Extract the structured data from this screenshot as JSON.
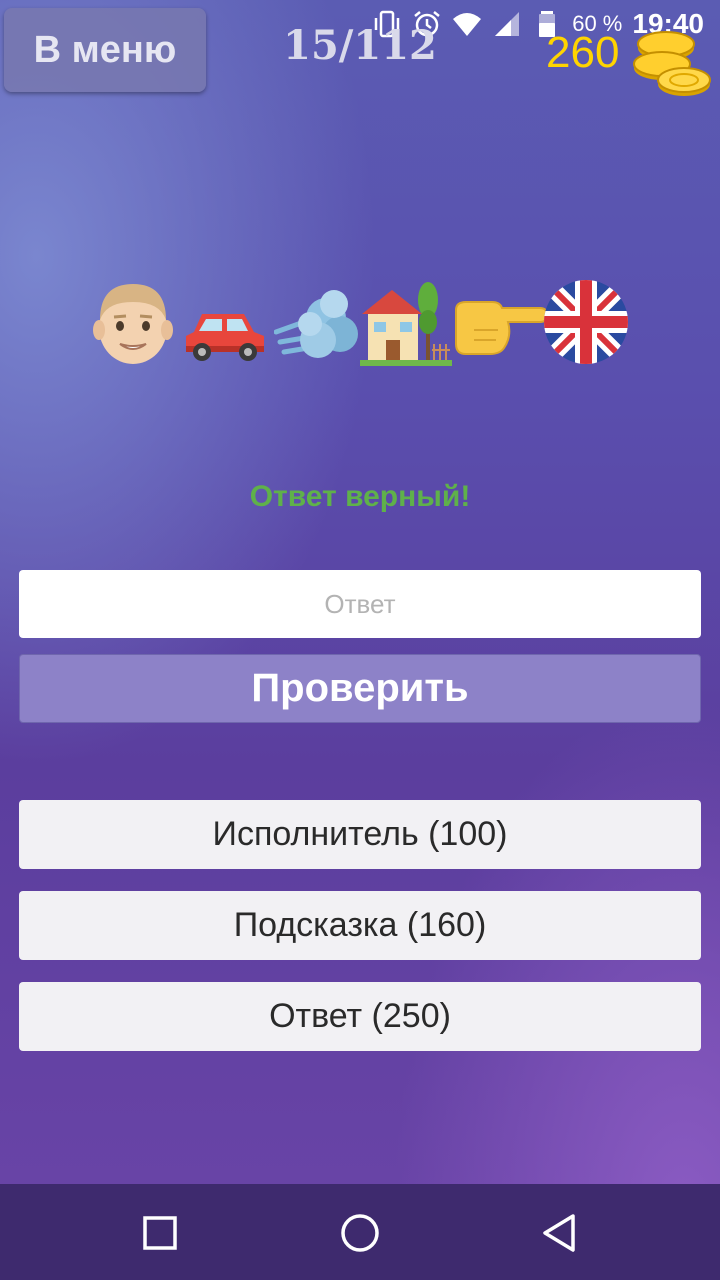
{
  "status_bar": {
    "battery_percent": "60 %",
    "time": "19:40",
    "icons": [
      "vibrate-icon",
      "alarm-icon",
      "wifi-icon",
      "signal-icon",
      "battery-icon"
    ]
  },
  "header": {
    "menu_label": "В меню",
    "level_counter": "15/112",
    "coins": "260"
  },
  "puzzle": {
    "emoji": [
      "man-face-emoji",
      "car-emoji",
      "wind-emoji",
      "house-with-garden-emoji",
      "pointing-right-emoji",
      "uk-flag-emoji"
    ]
  },
  "feedback": {
    "message": "Ответ верный!"
  },
  "answer": {
    "placeholder": "Ответ",
    "value": "",
    "check_label": "Проверить"
  },
  "hints": [
    {
      "label": "Исполнитель (100)"
    },
    {
      "label": "Подсказка (160)"
    },
    {
      "label": "Ответ (250)"
    }
  ],
  "colors": {
    "feedback_success": "#5fb14a",
    "coins": "#ffd400",
    "check_button": "#8d82c8"
  }
}
